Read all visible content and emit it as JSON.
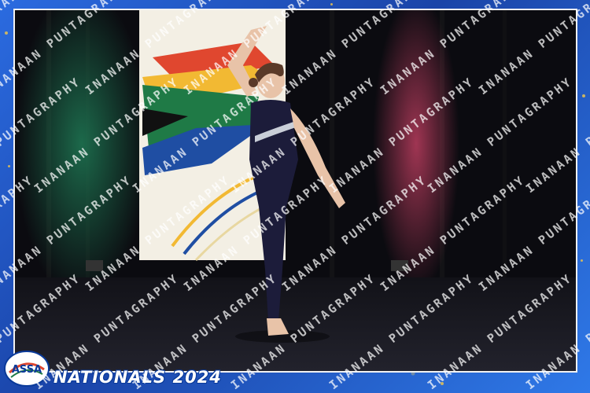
{
  "watermark": {
    "text": "INANAAN PUNTAGRAPHY"
  },
  "branding": {
    "logo_text": "ASSA",
    "event_text": "NATIONALS 2024"
  },
  "scene": {
    "colors": {
      "stage_back": "#0b0b10",
      "floor": "#1a1a22",
      "costume": "#1c1c3a",
      "skin": "#e8c3a8",
      "hair": "#5a3a28",
      "flag_red": "#e0472f",
      "flag_green": "#1f7a46",
      "flag_blue": "#1f4ea3",
      "flag_yellow": "#f2b933",
      "light_green": "#1f7a55",
      "light_pink": "#b03a5a"
    }
  }
}
